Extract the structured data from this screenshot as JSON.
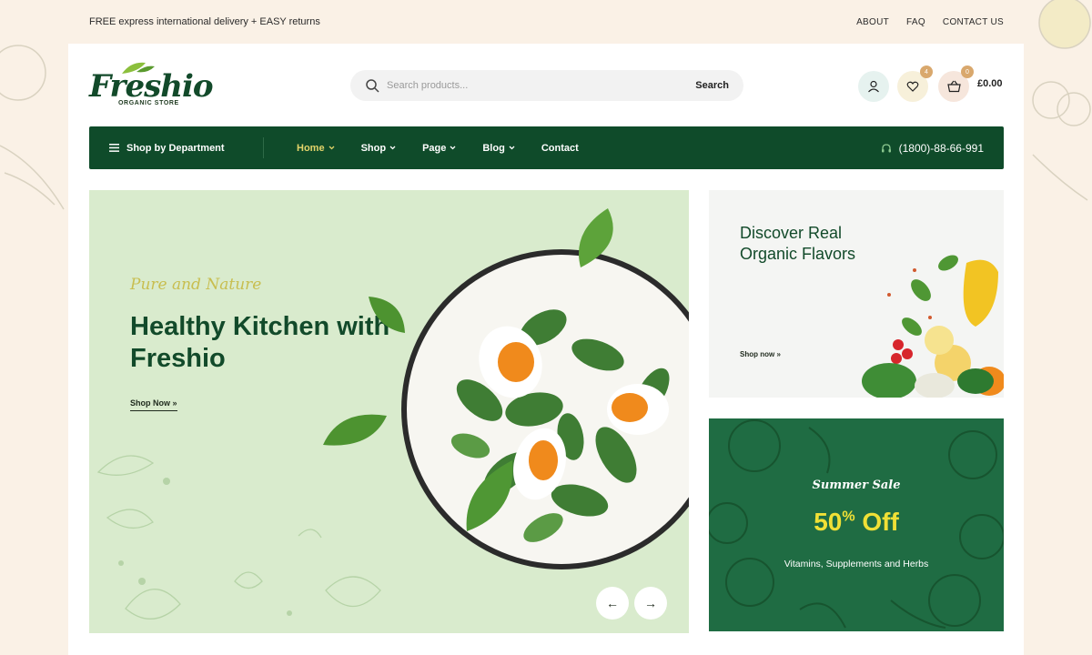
{
  "topbar": {
    "promo_text": "FREE express international delivery + EASY returns",
    "links": [
      "ABOUT",
      "FAQ",
      "CONTACT US"
    ]
  },
  "logo": {
    "name": "Freshio",
    "tagline": "ORGANIC STORE"
  },
  "search": {
    "placeholder": "Search products...",
    "button_label": "Search"
  },
  "header_icons": {
    "account": "user-icon",
    "wishlist": {
      "icon": "heart-icon",
      "count": "4"
    },
    "cart": {
      "icon": "basket-icon",
      "count": "0",
      "total": "£0.00"
    }
  },
  "nav": {
    "department_label": "Shop by Department",
    "items": [
      {
        "label": "Home",
        "active": true
      },
      {
        "label": "Shop"
      },
      {
        "label": "Page"
      },
      {
        "label": "Blog"
      },
      {
        "label": "Contact"
      }
    ],
    "phone": "(1800)-88-66-991"
  },
  "hero": {
    "tagline": "Pure and Nature",
    "title": "Healthy Kitchen with Freshio",
    "cta": "Shop Now »",
    "prev": "←",
    "next": "→"
  },
  "promo1": {
    "headline": "Discover Real Organic Flavors",
    "cta": "Shop now »"
  },
  "promo2": {
    "tagline": "Summer Sale",
    "discount_number": "50",
    "discount_suffix": "%",
    "discount_word": " Off",
    "subtitle": "Vitamins, Supplements and Herbs"
  },
  "colors": {
    "primary": "#0f4b2a",
    "accent": "#e3d46a",
    "hero_bg": "#d9ebcd",
    "sale_bg": "#1f6c43",
    "page_bg": "#faf1e6"
  }
}
